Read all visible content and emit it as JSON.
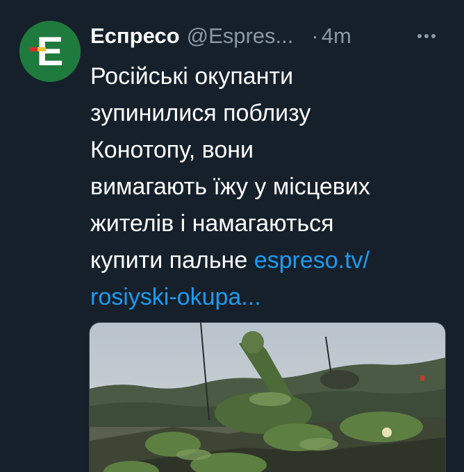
{
  "tweet": {
    "author_name": "Еспресо",
    "author_handle": "@Espres...",
    "separator": "·",
    "time": "4m",
    "text_lines": [
      "Російські окупанти",
      "зупинилися поблизу",
      "Конотопу, вони",
      "вимагають їжу у місцевих",
      "жителів і намагаються",
      "купити пальне "
    ],
    "link_part1": "espreso.tv/",
    "link_part2": "rosiyski-okupa...",
    "avatar_letter": "E",
    "more_icon": "more-horizontal-icon"
  },
  "colors": {
    "background": "#15202b",
    "name": "#ffffff",
    "secondary": "#8b98a5",
    "link": "#1d9bf0",
    "avatar_green": "#1f7a3e",
    "avatar_accent_red": "#d62b2b",
    "avatar_accent_yellow": "#f2c230"
  }
}
